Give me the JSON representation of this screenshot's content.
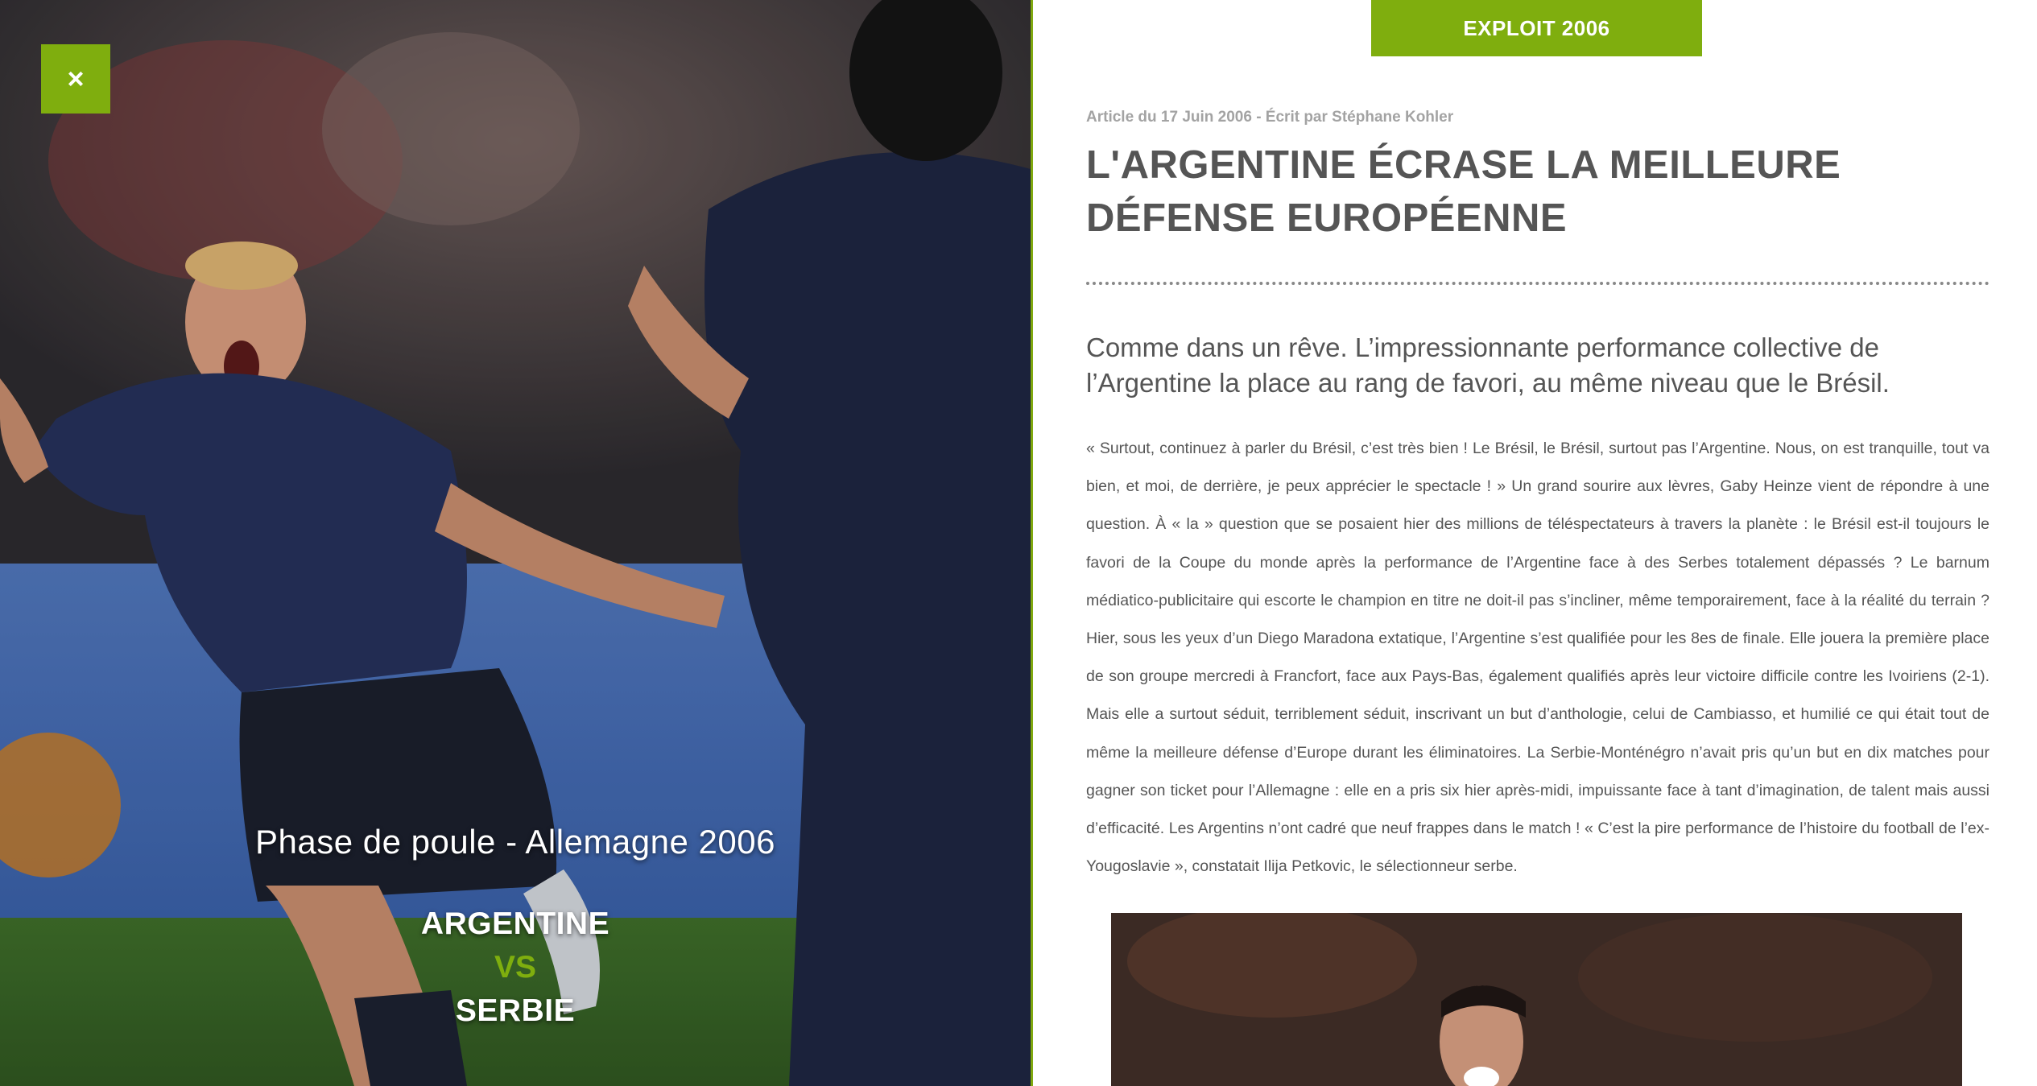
{
  "hero": {
    "close_label": "×",
    "phase": "Phase de poule - Allemagne 2006",
    "team1": "ARGENTINE",
    "vs": "VS",
    "team2": "SERBIE"
  },
  "article": {
    "tag": "EXPLOIT 2006",
    "meta": "Article du 17 Juin 2006 - Écrit par Stéphane Kohler",
    "title": "L'ARGENTINE ÉCRASE LA MEILLEURE DÉFENSE EUROPÉENNE",
    "lead": "Comme dans un rêve. L’impressionnante performance collective de l’Argentine la place au rang de favori, au même niveau que le Brésil.",
    "body": "« Surtout, continuez à parler du Brésil, c’est très bien ! Le Brésil, le Brésil, surtout pas l’Argentine. Nous, on est tranquille, tout va bien, et moi, de derrière, je peux apprécier le spectacle ! » Un grand sourire aux lèvres, Gaby Heinze vient de répondre à une question. À « la » question que se posaient hier des millions de téléspectateurs à travers la planète : le Brésil est-il toujours le favori de la Coupe du monde après la performance de l’Argentine face à des Serbes totalement dépassés ? Le barnum médiatico-publicitaire qui escorte le champion en titre ne doit-il pas s’incliner, même temporairement, face à la réalité du terrain ? Hier, sous les yeux d’un Diego Maradona extatique, l’Argentine s’est qualifiée pour les 8es de finale. Elle jouera la première place de son groupe mercredi à Francfort, face aux Pays-Bas, également qualifiés après leur victoire difficile contre les Ivoiriens (2-1). Mais elle a surtout séduit, terriblement séduit, inscrivant un but d’anthologie, celui de Cambiasso, et humilié ce qui était tout de même la meilleure défense d’Europe durant les éliminatoires. La Serbie-Monténégro n’avait pris qu’un but en dix matches pour gagner son ticket pour l’Allemagne : elle en a pris six hier après-midi, impuissante face à tant d’imagination, de talent mais aussi d’efficacité. Les Argentins n’ont cadré que neuf frappes dans le match ! « C’est la pire performance de l’histoire du football de l’ex-Yougoslavie », constatait Ilija Petkovic, le sélectionneur serbe."
  },
  "colors": {
    "accent": "#7fae0e",
    "text": "#555555",
    "meta": "#a3a3a3"
  }
}
